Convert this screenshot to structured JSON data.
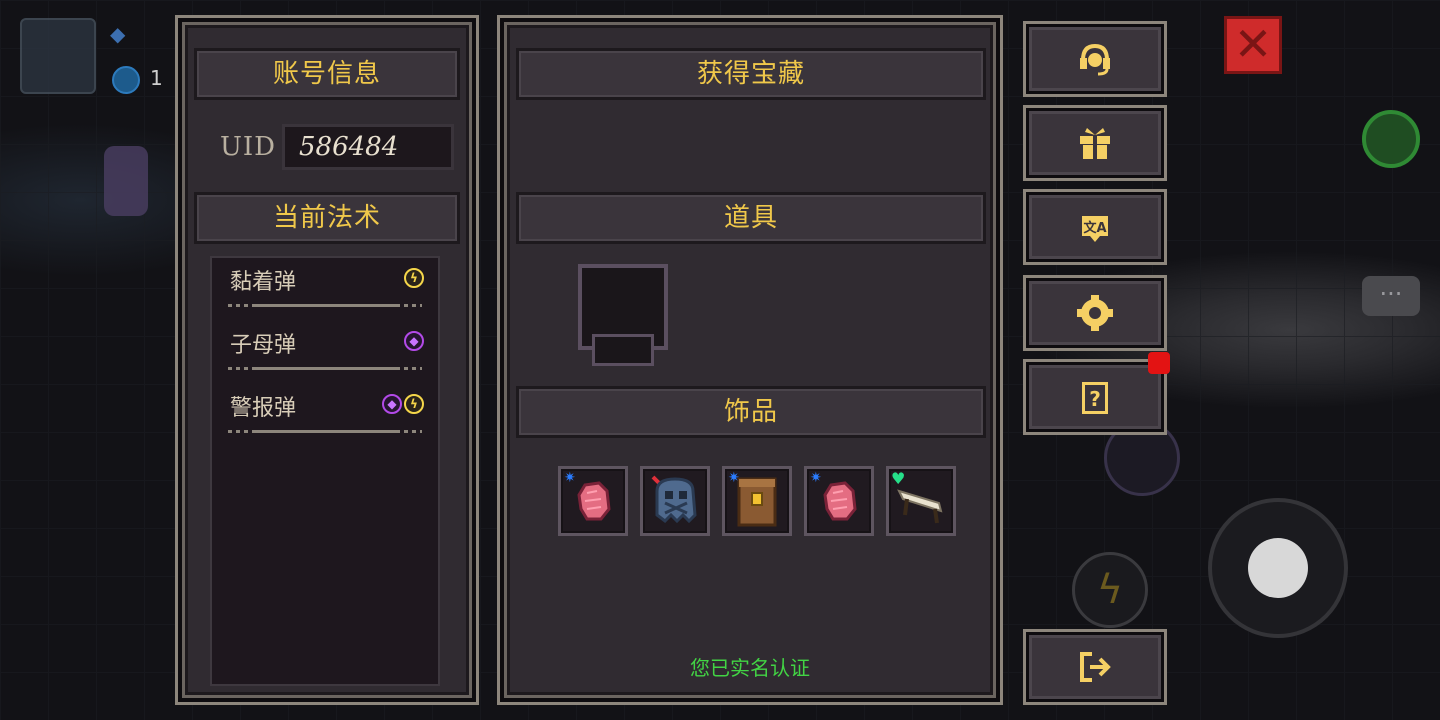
{
  "account_panel": {
    "title": "账号信息",
    "uid_label": "UID",
    "uid_value": "586484",
    "spells_title": "当前法术",
    "spells": [
      {
        "name": "黏着弹",
        "elements": [
          "lightning"
        ]
      },
      {
        "name": "子母弹",
        "elements": [
          "arcane"
        ]
      },
      {
        "name": "警报弹",
        "elements": [
          "arcane",
          "lightning"
        ]
      }
    ]
  },
  "treasure_panel": {
    "title": "获得宝藏",
    "items_title": "道具",
    "accessories_title": "饰品",
    "accessories": [
      {
        "icon": "pink-gem-icon",
        "badge": "star",
        "badge_color": "#2a7cff"
      },
      {
        "icon": "ghost-skull-icon",
        "badge": "cursed",
        "badge_color": "#e0303a"
      },
      {
        "icon": "scroll-backpack-icon",
        "badge": "star",
        "badge_color": "#2a7cff"
      },
      {
        "icon": "pink-gem-icon",
        "badge": "star",
        "badge_color": "#2a7cff"
      },
      {
        "icon": "bone-bench-icon",
        "badge": "heart",
        "badge_color": "#26e08a"
      }
    ],
    "verified_text": "您已实名认证"
  },
  "side_menu": [
    {
      "name": "customer-service-button",
      "icon": "headset-icon"
    },
    {
      "name": "gift-button",
      "icon": "gift-icon"
    },
    {
      "name": "translate-button",
      "icon": "language-icon"
    },
    {
      "name": "settings-button",
      "icon": "gear-icon"
    },
    {
      "name": "help-button",
      "icon": "help-book-icon",
      "has_notification": true
    },
    {
      "name": "exit-button",
      "icon": "exit-icon"
    }
  ],
  "background": {
    "coin_count": "1"
  },
  "colors": {
    "title_gold": "#f0c84a",
    "verified_green": "#42d444",
    "notification_red": "#e31313"
  }
}
